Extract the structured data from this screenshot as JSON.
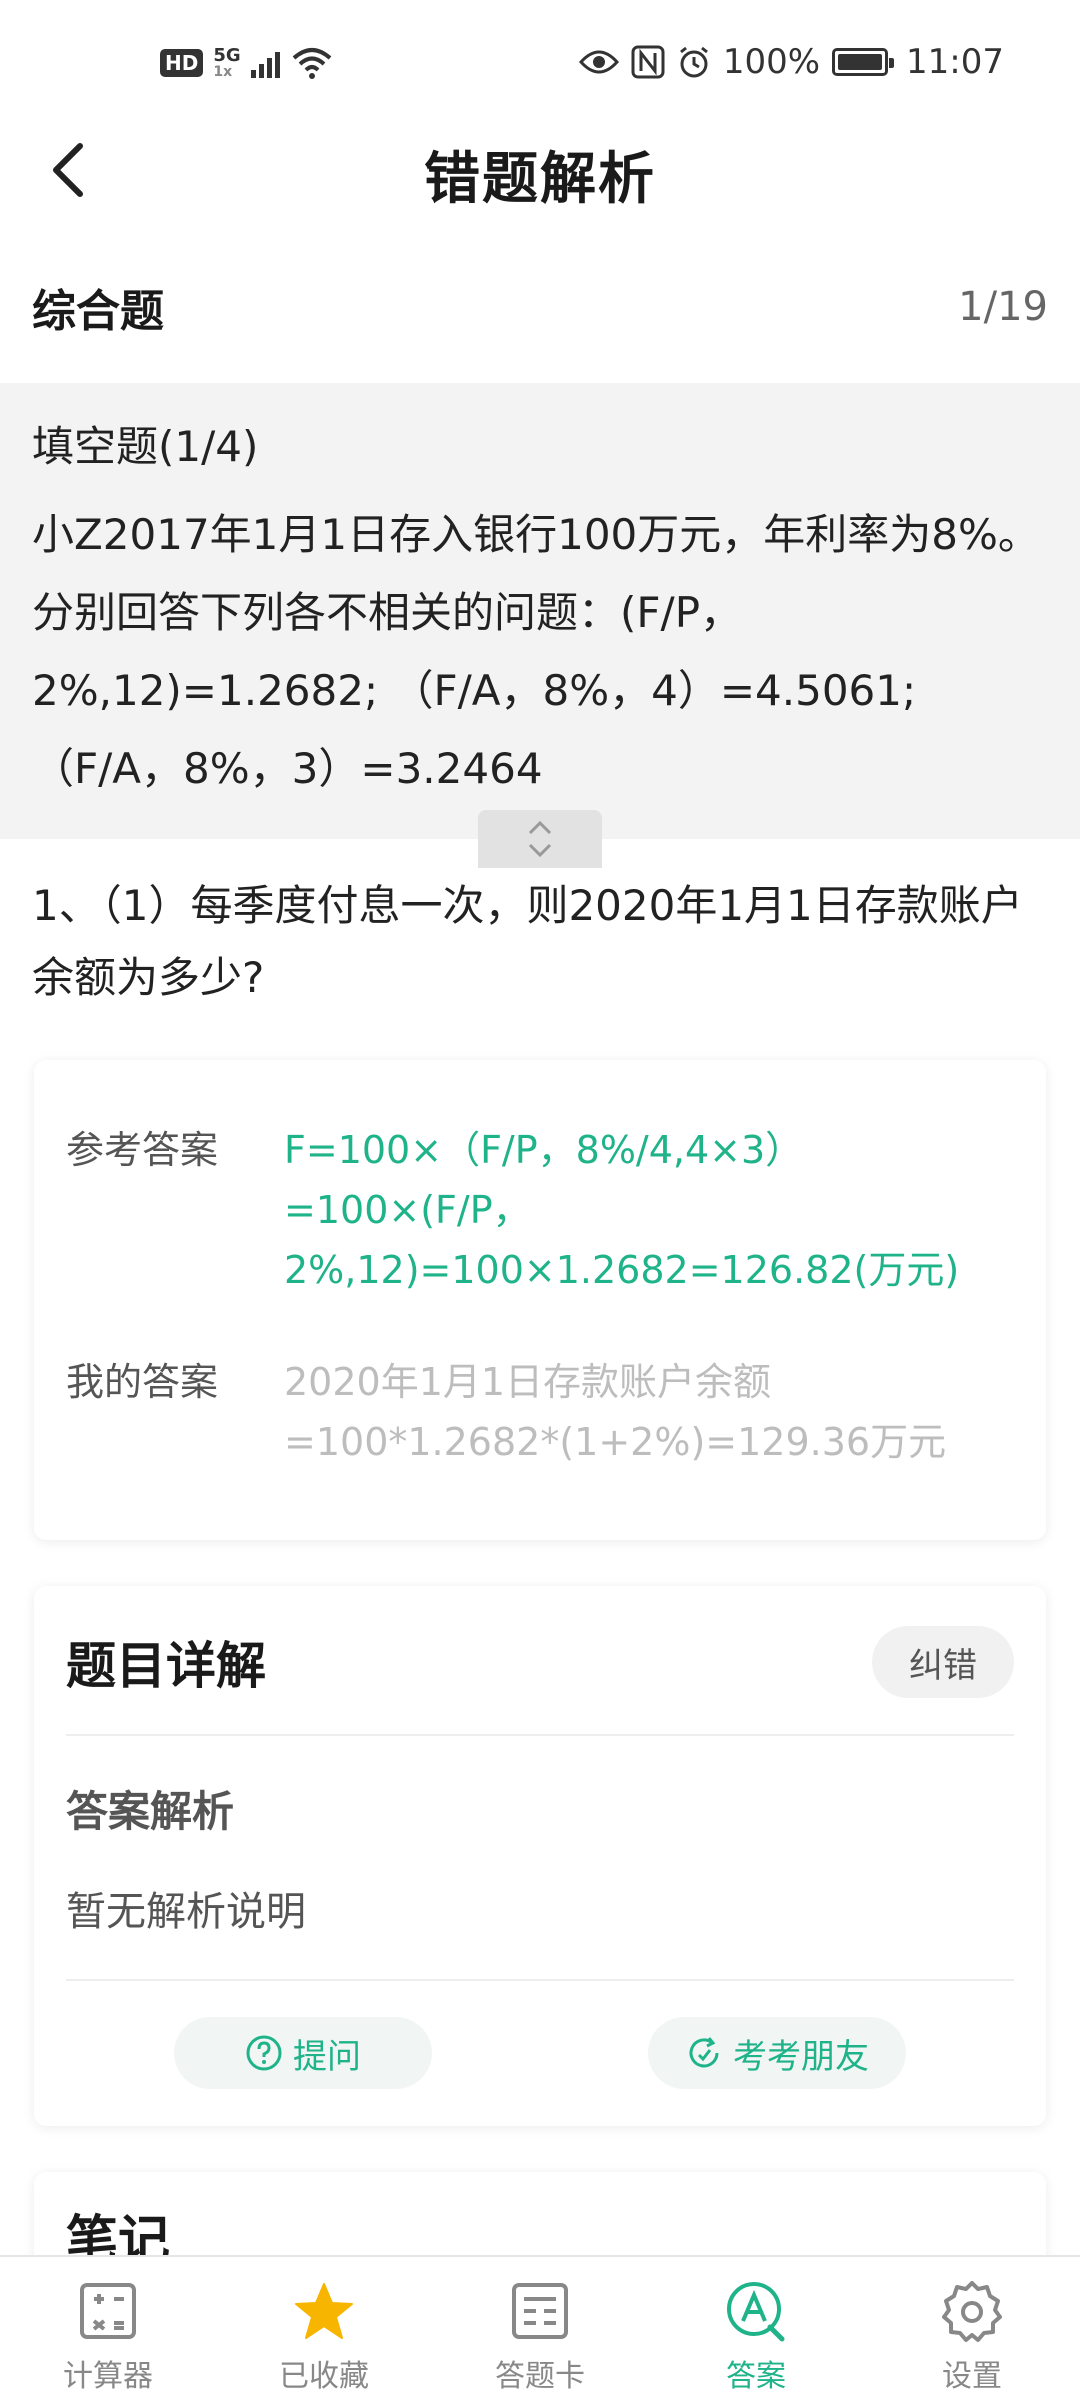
{
  "status_bar": {
    "hd": "HD",
    "network": "5G",
    "network_sub": "1x",
    "battery": "100%",
    "time": "11:07"
  },
  "header": {
    "title": "错题解析"
  },
  "section": {
    "title": "综合题",
    "progress": "1/19"
  },
  "stem": {
    "type_label": "填空题(1/4)",
    "text": "小Z2017年1月1日存入银行100万元，年利率为8%。分别回答下列各不相关的问题：(F/P，2%,12)=1.2682; （F/A，8%，4）=4.5061; （F/A，8%，3）=3.2464"
  },
  "question": {
    "text": "1、（1）每季度付息一次，则2020年1月1日存款账户余额为多少?"
  },
  "answer": {
    "ref_label": "参考答案",
    "ref_value": "F=100×（F/P，8%/4,4×3）=100×(F/P，2%,12)=100×1.2682=126.82(万元)",
    "mine_label": "我的答案",
    "mine_value": "2020年1月1日存款账户余额=100*1.2682*(1+2%)=129.36万元"
  },
  "detail": {
    "title": "题目详解",
    "report_label": "纠错",
    "analysis_title": "答案解析",
    "analysis_text": "暂无解析说明",
    "ask_label": "提问",
    "friends_label": "考考朋友"
  },
  "notes": {
    "title": "笔记"
  },
  "tabs": [
    {
      "label": "计算器",
      "icon": "calculator-icon"
    },
    {
      "label": "已收藏",
      "icon": "star-icon"
    },
    {
      "label": "答题卡",
      "icon": "answer-card-icon"
    },
    {
      "label": "答案",
      "icon": "answer-icon"
    },
    {
      "label": "设置",
      "icon": "settings-icon"
    }
  ],
  "colors": {
    "accent": "#1fb38a",
    "star": "#f8b500",
    "muted": "#bdbdbd"
  }
}
